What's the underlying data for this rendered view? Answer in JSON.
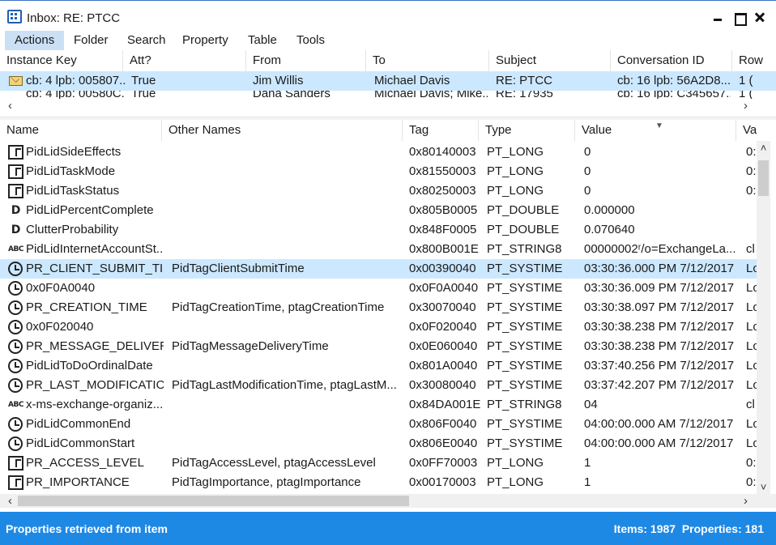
{
  "window": {
    "title": "Inbox: RE: PTCC"
  },
  "menu": [
    "Actions",
    "Folder",
    "Search",
    "Property",
    "Table",
    "Tools"
  ],
  "top_list": {
    "columns": [
      "Instance Key",
      "Att?",
      "From",
      "To",
      "Subject",
      "Conversation ID",
      "Row"
    ],
    "rows": [
      [
        "cb: 4 lpb: 005807...",
        "True",
        "Jim Willis",
        "Michael Davis",
        "RE: PTCC",
        "cb: 16 lpb: 56A2D8...",
        "1 ("
      ],
      [
        "cb: 4 lpb: 00580C...",
        "True",
        "Dana Sanders",
        "Michael Davis; Mike...",
        "RE: 17935",
        "cb: 16 lpb: C345657...",
        "1 ("
      ]
    ]
  },
  "prop_list": {
    "columns": [
      "Name",
      "Other Names",
      "Tag",
      "Type",
      "Value",
      "Va"
    ],
    "rows": [
      {
        "icon": "grid",
        "name": "PidLidSideEffects",
        "other": "",
        "tag": "0x80140003",
        "type": "PT_LONG",
        "value": "0",
        "extra": "0:"
      },
      {
        "icon": "grid",
        "name": "PidLidTaskMode",
        "other": "",
        "tag": "0x81550003",
        "type": "PT_LONG",
        "value": "0",
        "extra": "0:"
      },
      {
        "icon": "grid",
        "name": "PidLidTaskStatus",
        "other": "",
        "tag": "0x80250003",
        "type": "PT_LONG",
        "value": "0",
        "extra": "0:"
      },
      {
        "icon": "d",
        "name": "PidLidPercentComplete",
        "other": "",
        "tag": "0x805B0005",
        "type": "PT_DOUBLE",
        "value": "0.000000",
        "extra": ""
      },
      {
        "icon": "d",
        "name": "ClutterProbability",
        "other": "",
        "tag": "0x848F0005",
        "type": "PT_DOUBLE",
        "value": "0.070640",
        "extra": ""
      },
      {
        "icon": "abc",
        "name": "PidLidInternetAccountSt...",
        "other": "",
        "tag": "0x800B001E",
        "type": "PT_STRING8",
        "value": "00000002ʳ/o=ExchangeLa...",
        "extra": "cl"
      },
      {
        "icon": "clock",
        "name": "PR_CLIENT_SUBMIT_TIME",
        "other": "PidTagClientSubmitTime",
        "tag": "0x00390040",
        "type": "PT_SYSTIME",
        "value": "03:30:36.000 PM 7/12/2017",
        "extra": "Lo"
      },
      {
        "icon": "clock",
        "name": "0x0F0A0040",
        "other": "",
        "tag": "0x0F0A0040",
        "type": "PT_SYSTIME",
        "value": "03:30:36.009 PM 7/12/2017",
        "extra": "Lo"
      },
      {
        "icon": "clock",
        "name": "PR_CREATION_TIME",
        "other": "PidTagCreationTime, ptagCreationTime",
        "tag": "0x30070040",
        "type": "PT_SYSTIME",
        "value": "03:30:38.097 PM 7/12/2017",
        "extra": "Lo"
      },
      {
        "icon": "clock",
        "name": "0x0F020040",
        "other": "",
        "tag": "0x0F020040",
        "type": "PT_SYSTIME",
        "value": "03:30:38.238 PM 7/12/2017",
        "extra": "Lo"
      },
      {
        "icon": "clock",
        "name": "PR_MESSAGE_DELIVERY...",
        "other": "PidTagMessageDeliveryTime",
        "tag": "0x0E060040",
        "type": "PT_SYSTIME",
        "value": "03:30:38.238 PM 7/12/2017",
        "extra": "Lo"
      },
      {
        "icon": "clock",
        "name": "PidLidToDoOrdinalDate",
        "other": "",
        "tag": "0x801A0040",
        "type": "PT_SYSTIME",
        "value": "03:37:40.256 PM 7/12/2017",
        "extra": "Lo"
      },
      {
        "icon": "clock",
        "name": "PR_LAST_MODIFICATIO...",
        "other": "PidTagLastModificationTime, ptagLastM...",
        "tag": "0x30080040",
        "type": "PT_SYSTIME",
        "value": "03:37:42.207 PM 7/12/2017",
        "extra": "Lo"
      },
      {
        "icon": "abc",
        "name": "x-ms-exchange-organiz...",
        "other": "",
        "tag": "0x84DA001E",
        "type": "PT_STRING8",
        "value": "04",
        "extra": "cl"
      },
      {
        "icon": "clock",
        "name": "PidLidCommonEnd",
        "other": "",
        "tag": "0x806F0040",
        "type": "PT_SYSTIME",
        "value": "04:00:00.000 AM 7/12/2017",
        "extra": "Lo"
      },
      {
        "icon": "clock",
        "name": "PidLidCommonStart",
        "other": "",
        "tag": "0x806E0040",
        "type": "PT_SYSTIME",
        "value": "04:00:00.000 AM 7/12/2017",
        "extra": "Lo"
      },
      {
        "icon": "grid",
        "name": "PR_ACCESS_LEVEL",
        "other": "PidTagAccessLevel, ptagAccessLevel",
        "tag": "0x0FF70003",
        "type": "PT_LONG",
        "value": "1",
        "extra": "0:"
      },
      {
        "icon": "grid",
        "name": "PR_IMPORTANCE",
        "other": "PidTagImportance, ptagImportance",
        "tag": "0x00170003",
        "type": "PT_LONG",
        "value": "1",
        "extra": "0:"
      }
    ]
  },
  "status": {
    "message": "Properties retrieved from item",
    "counts": "Items: 1987  Properties: 181"
  }
}
